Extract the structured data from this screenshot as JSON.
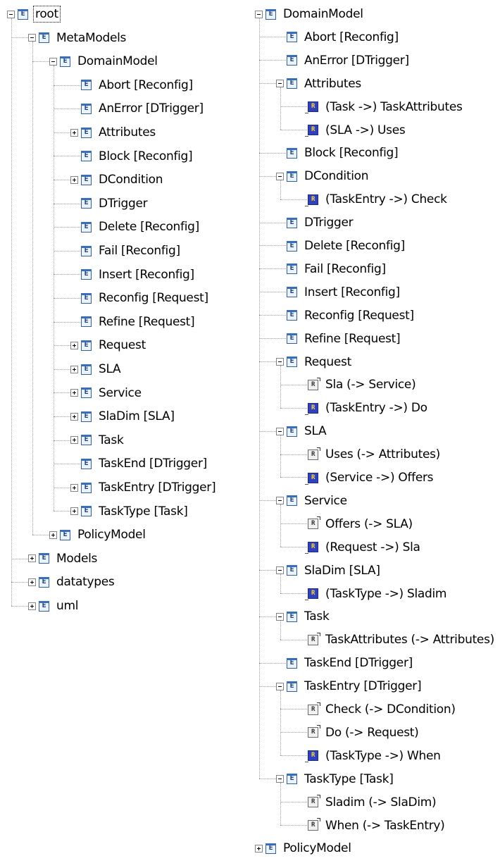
{
  "left_tree": [
    {
      "label": "root",
      "depth": 0,
      "toggle": "minus",
      "icon": "class-icon",
      "focused": true
    },
    {
      "label": "MetaModels",
      "depth": 1,
      "toggle": "minus",
      "icon": "class-icon"
    },
    {
      "label": "DomainModel",
      "depth": 2,
      "toggle": "minus",
      "icon": "class-icon"
    },
    {
      "label": "Abort [Reconfig]",
      "depth": 3,
      "toggle": "none",
      "icon": "class-icon"
    },
    {
      "label": "AnError [DTrigger]",
      "depth": 3,
      "toggle": "none",
      "icon": "class-icon"
    },
    {
      "label": "Attributes",
      "depth": 3,
      "toggle": "plus",
      "icon": "class-icon"
    },
    {
      "label": "Block [Reconfig]",
      "depth": 3,
      "toggle": "none",
      "icon": "class-icon"
    },
    {
      "label": "DCondition",
      "depth": 3,
      "toggle": "plus",
      "icon": "class-icon"
    },
    {
      "label": "DTrigger",
      "depth": 3,
      "toggle": "none",
      "icon": "class-icon"
    },
    {
      "label": "Delete [Reconfig]",
      "depth": 3,
      "toggle": "none",
      "icon": "class-icon"
    },
    {
      "label": "Fail [Reconfig]",
      "depth": 3,
      "toggle": "none",
      "icon": "class-icon"
    },
    {
      "label": "Insert [Reconfig]",
      "depth": 3,
      "toggle": "none",
      "icon": "class-icon"
    },
    {
      "label": "Reconfig [Request]",
      "depth": 3,
      "toggle": "none",
      "icon": "class-icon"
    },
    {
      "label": "Refine [Request]",
      "depth": 3,
      "toggle": "none",
      "icon": "class-icon"
    },
    {
      "label": "Request",
      "depth": 3,
      "toggle": "plus",
      "icon": "class-icon"
    },
    {
      "label": "SLA",
      "depth": 3,
      "toggle": "plus",
      "icon": "class-icon"
    },
    {
      "label": "Service",
      "depth": 3,
      "toggle": "plus",
      "icon": "class-icon"
    },
    {
      "label": "SlaDim [SLA]",
      "depth": 3,
      "toggle": "plus",
      "icon": "class-icon"
    },
    {
      "label": "Task",
      "depth": 3,
      "toggle": "plus",
      "icon": "class-icon"
    },
    {
      "label": "TaskEnd [DTrigger]",
      "depth": 3,
      "toggle": "none",
      "icon": "class-icon"
    },
    {
      "label": "TaskEntry [DTrigger]",
      "depth": 3,
      "toggle": "plus",
      "icon": "class-icon"
    },
    {
      "label": "TaskType [Task]",
      "depth": 3,
      "toggle": "plus",
      "icon": "class-icon"
    },
    {
      "label": "PolicyModel",
      "depth": 2,
      "toggle": "plus",
      "icon": "class-icon"
    },
    {
      "label": "Models",
      "depth": 1,
      "toggle": "plus",
      "icon": "class-icon"
    },
    {
      "label": "datatypes",
      "depth": 1,
      "toggle": "plus",
      "icon": "class-icon"
    },
    {
      "label": "uml",
      "depth": 1,
      "toggle": "plus",
      "icon": "class-icon"
    }
  ],
  "right_tree": [
    {
      "label": "DomainModel",
      "depth": 0,
      "toggle": "minus",
      "icon": "class-icon"
    },
    {
      "label": "Abort [Reconfig]",
      "depth": 1,
      "toggle": "none",
      "icon": "class-icon"
    },
    {
      "label": "AnError [DTrigger]",
      "depth": 1,
      "toggle": "none",
      "icon": "class-icon"
    },
    {
      "label": "Attributes",
      "depth": 1,
      "toggle": "minus",
      "icon": "class-icon"
    },
    {
      "label": "(Task ->) TaskAttributes",
      "depth": 2,
      "toggle": "none",
      "icon": "back-reference-icon"
    },
    {
      "label": "(SLA ->) Uses",
      "depth": 2,
      "toggle": "none",
      "icon": "back-reference-icon"
    },
    {
      "label": "Block [Reconfig]",
      "depth": 1,
      "toggle": "none",
      "icon": "class-icon"
    },
    {
      "label": "DCondition",
      "depth": 1,
      "toggle": "minus",
      "icon": "class-icon"
    },
    {
      "label": "(TaskEntry ->) Check",
      "depth": 2,
      "toggle": "none",
      "icon": "back-reference-icon"
    },
    {
      "label": "DTrigger",
      "depth": 1,
      "toggle": "none",
      "icon": "class-icon"
    },
    {
      "label": "Delete [Reconfig]",
      "depth": 1,
      "toggle": "none",
      "icon": "class-icon"
    },
    {
      "label": "Fail [Reconfig]",
      "depth": 1,
      "toggle": "none",
      "icon": "class-icon"
    },
    {
      "label": "Insert [Reconfig]",
      "depth": 1,
      "toggle": "none",
      "icon": "class-icon"
    },
    {
      "label": "Reconfig [Request]",
      "depth": 1,
      "toggle": "none",
      "icon": "class-icon"
    },
    {
      "label": "Refine [Request]",
      "depth": 1,
      "toggle": "none",
      "icon": "class-icon"
    },
    {
      "label": "Request",
      "depth": 1,
      "toggle": "minus",
      "icon": "class-icon"
    },
    {
      "label": "Sla (-> Service)",
      "depth": 2,
      "toggle": "none",
      "icon": "reference-icon"
    },
    {
      "label": "(TaskEntry ->) Do",
      "depth": 2,
      "toggle": "none",
      "icon": "back-reference-icon"
    },
    {
      "label": "SLA",
      "depth": 1,
      "toggle": "minus",
      "icon": "class-icon"
    },
    {
      "label": "Uses (-> Attributes)",
      "depth": 2,
      "toggle": "none",
      "icon": "reference-icon"
    },
    {
      "label": "(Service ->) Offers",
      "depth": 2,
      "toggle": "none",
      "icon": "back-reference-icon"
    },
    {
      "label": "Service",
      "depth": 1,
      "toggle": "minus",
      "icon": "class-icon"
    },
    {
      "label": "Offers (-> SLA)",
      "depth": 2,
      "toggle": "none",
      "icon": "reference-icon"
    },
    {
      "label": "(Request ->) Sla",
      "depth": 2,
      "toggle": "none",
      "icon": "back-reference-icon"
    },
    {
      "label": "SlaDim [SLA]",
      "depth": 1,
      "toggle": "minus",
      "icon": "class-icon"
    },
    {
      "label": "(TaskType ->) Sladim",
      "depth": 2,
      "toggle": "none",
      "icon": "back-reference-icon"
    },
    {
      "label": "Task",
      "depth": 1,
      "toggle": "minus",
      "icon": "class-icon"
    },
    {
      "label": "TaskAttributes (-> Attributes)",
      "depth": 2,
      "toggle": "none",
      "icon": "reference-icon"
    },
    {
      "label": "TaskEnd [DTrigger]",
      "depth": 1,
      "toggle": "none",
      "icon": "class-icon"
    },
    {
      "label": "TaskEntry [DTrigger]",
      "depth": 1,
      "toggle": "minus",
      "icon": "class-icon"
    },
    {
      "label": "Check (-> DCondition)",
      "depth": 2,
      "toggle": "none",
      "icon": "reference-icon"
    },
    {
      "label": "Do (-> Request)",
      "depth": 2,
      "toggle": "none",
      "icon": "reference-icon"
    },
    {
      "label": "(TaskType ->) When",
      "depth": 2,
      "toggle": "none",
      "icon": "back-reference-icon"
    },
    {
      "label": "TaskType [Task]",
      "depth": 1,
      "toggle": "minus",
      "icon": "class-icon"
    },
    {
      "label": "Sladim (-> SlaDim)",
      "depth": 2,
      "toggle": "none",
      "icon": "reference-icon"
    },
    {
      "label": "When (-> TaskEntry)",
      "depth": 2,
      "toggle": "none",
      "icon": "reference-icon"
    },
    {
      "label": "PolicyModel",
      "depth": 0,
      "toggle": "plus",
      "icon": "class-icon"
    }
  ],
  "icon_glyphs": {
    "class-icon": "E",
    "reference-icon": "R",
    "back-reference-icon": "R"
  }
}
